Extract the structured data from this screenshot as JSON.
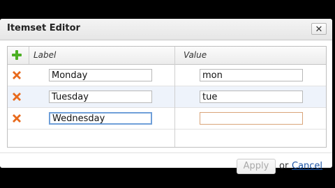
{
  "dialog": {
    "title": "Itemset Editor",
    "close_label": "✕"
  },
  "grid": {
    "columns": {
      "label": "Label",
      "value": "Value"
    },
    "rows": [
      {
        "label": "Monday",
        "value": "mon"
      },
      {
        "label": "Tuesday",
        "value": "tue"
      },
      {
        "label": "Wednesday",
        "value": ""
      }
    ]
  },
  "footer": {
    "apply_label": "Apply",
    "or_text": "or",
    "cancel_label": "Cancel"
  },
  "colors": {
    "add_icon": "#4caf24",
    "delete_icon": "#e86a1c",
    "link": "#1b54a6",
    "focus_border": "#6f9fd9"
  },
  "icons": {
    "add": "plus-icon",
    "delete": "x-icon"
  }
}
